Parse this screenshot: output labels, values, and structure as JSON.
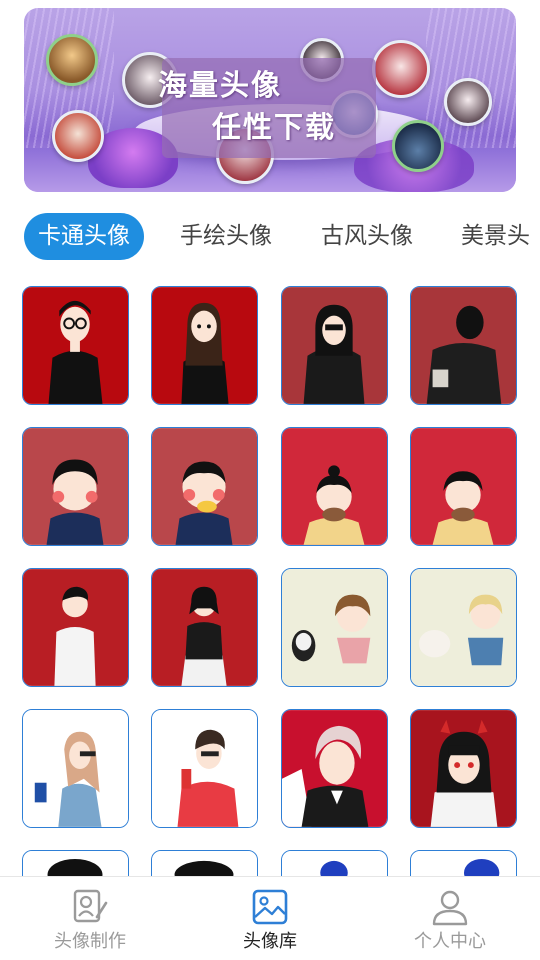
{
  "banner": {
    "line1": "海量头像",
    "line2": "任性下载"
  },
  "tabs": [
    {
      "label": "卡通头像",
      "active": true
    },
    {
      "label": "手绘头像",
      "active": false
    },
    {
      "label": "古风头像",
      "active": false
    },
    {
      "label": "美景头",
      "active": false
    }
  ],
  "avatars": [
    {
      "name": "cartoon-boy-glasses-red"
    },
    {
      "name": "cartoon-girl-long-hair-red"
    },
    {
      "name": "cartoon-girl-hoodie-dark-red"
    },
    {
      "name": "cartoon-boy-back-dark-red"
    },
    {
      "name": "cartoon-girl-kiss-navy"
    },
    {
      "name": "cartoon-boy-kiss-yellow"
    },
    {
      "name": "cartoon-girl-beard-costume"
    },
    {
      "name": "cartoon-boy-beard-costume"
    },
    {
      "name": "cartoon-boy-white-shirt"
    },
    {
      "name": "cartoon-girl-skirt"
    },
    {
      "name": "anime-girl-with-mask"
    },
    {
      "name": "anime-boy-with-cat"
    },
    {
      "name": "cartoon-girl-sunglasses-drink"
    },
    {
      "name": "cartoon-boy-drink-red"
    },
    {
      "name": "anime-boy-white-hair"
    },
    {
      "name": "anime-girl-devil-horns"
    }
  ],
  "bottom_nav": [
    {
      "label": "头像制作",
      "icon": "portrait-edit-icon",
      "active": false
    },
    {
      "label": "头像库",
      "icon": "image-gallery-icon",
      "active": true
    },
    {
      "label": "个人中心",
      "icon": "person-icon",
      "active": false
    }
  ],
  "colors": {
    "accent": "#1f8ee0",
    "tab_text": "#444444",
    "nav_inactive": "#9a9a9a",
    "nav_active": "#222222",
    "nav_icon_active": "#2e7fd6"
  }
}
